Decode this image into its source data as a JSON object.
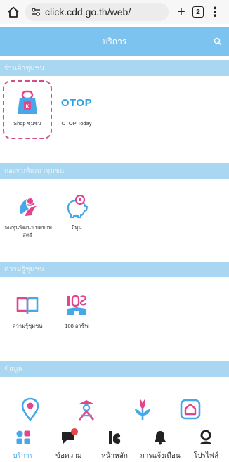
{
  "browser": {
    "url": "click.cdd.go.th/web/",
    "tab_count": "2",
    "new_tab": "+"
  },
  "header": {
    "title": "บริการ"
  },
  "sections": [
    {
      "title": "ร้านค้าชุมชน",
      "items": [
        {
          "label": "Shop ชุมชน",
          "icon": "shopping-bag-icon"
        },
        {
          "label": "OTOP Today",
          "icon": "otop-logo",
          "logo_text": "OTOP"
        }
      ]
    },
    {
      "title": "กองทุนพัฒนาชุมชน",
      "items": [
        {
          "label": "กองทุนพัฒนา บทบาทสตรี",
          "icon": "women-fund-icon"
        },
        {
          "label": "มีทุน",
          "icon": "piggy-bank-icon"
        }
      ]
    },
    {
      "title": "ความรู้ชุมชน",
      "items": [
        {
          "label": "ความรู้ชุมชน",
          "icon": "book-icon"
        },
        {
          "label": "108 อาชีพ",
          "icon": "occupation-icon"
        }
      ]
    },
    {
      "title": "ข้อมูล",
      "items": [
        {
          "label": "",
          "icon": "location-pin-icon"
        },
        {
          "label": "",
          "icon": "person-icon"
        },
        {
          "label": "",
          "icon": "plant-icon"
        },
        {
          "label": "",
          "icon": "house-icon"
        }
      ]
    }
  ],
  "bottom_nav": [
    {
      "label": "บริการ",
      "icon": "grid-icon",
      "active": true
    },
    {
      "label": "ข้อความ",
      "icon": "chat-icon",
      "badge": true
    },
    {
      "label": "หน้าหลัก",
      "icon": "home-logo-icon"
    },
    {
      "label": "การแจ้งเตือน",
      "icon": "bell-icon"
    },
    {
      "label": "โปรไฟล์",
      "icon": "profile-icon"
    }
  ],
  "colors": {
    "header": "#7cc4ef",
    "section": "#a9d6f1",
    "accent_blue": "#47a7e8",
    "accent_pink": "#e2458a",
    "highlight": "#cf4f8a"
  }
}
